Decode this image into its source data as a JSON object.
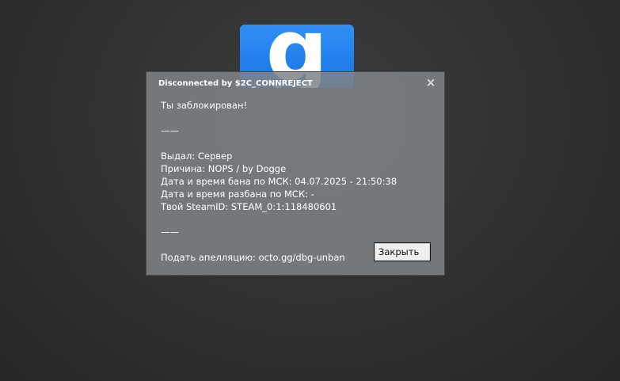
{
  "logo": {
    "glyph": "g",
    "color": "#1f7ef0"
  },
  "dialog": {
    "title": "Disconnected by $2C_CONNREJECT",
    "close_icon": "×",
    "message": {
      "line1": "Ты заблокирован!",
      "divider1": "——",
      "issuer": "Выдал: Сервер",
      "reason": "Причина: NOPS / by Dogge",
      "ban_date": "Дата и время бана по МСК: 04.07.2025 - 21:50:38",
      "unban_date": "Дата и время разбана по МСК: -",
      "steam_id": "Твой SteamID: STEAM_0:1:118480601",
      "divider2": "——",
      "appeal": "Подать апелляцию: octo.gg/dbg-unban"
    },
    "close_button_label": "Закрыть"
  }
}
